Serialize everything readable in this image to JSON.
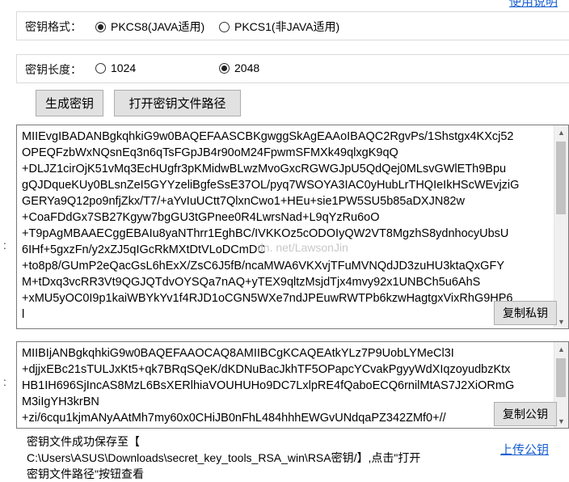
{
  "top_link": "使用说明",
  "format": {
    "label": "密钥格式：",
    "options": [
      "PKCS8(JAVA适用)",
      "PKCS1(非JAVA适用)"
    ],
    "selected": 0
  },
  "length": {
    "label": "密钥长度：",
    "options": [
      "1024",
      "2048"
    ],
    "selected": 1
  },
  "buttons": {
    "generate": "生成密钥",
    "open_path": "打开密钥文件路径"
  },
  "private_key": {
    "lines": [
      "MIIEvgIBADANBgkqhkiG9w0BAQEFAASCBKgwggSkAgEAAoIBAQC2RgvPs/1Shstgx4KXcj52",
      "OPEQFzbWxNQsnEq3n6qTsFGpJB4r90oM24FpwmSFMXk49qlxgK9qQ",
      "+DLJZ1cirOjK51vMq3EcHUgfr3pKMidwBLwzMvoGxcRGWGJpU5QdQej0MLsvGWlETh9Bpu",
      "gQJDqueKUy0BLsnZeI5GYYzeliBgfeSsE37OL/pyq7WSOYA3IAC0yHubLrTHQIeIkHScWEvjziG",
      "GERYa9Q12po9nfjZkx/T7/+aYvIuUCtt7QlxnCwo1+HEu+sie1PW5SU5b85aDXJN82w",
      "+CoaFDdGx7SB27Kgyw7bgGU3tGPnee0R4LwrsNad+L9qYzRu6oO",
      "+T9pAgMBAAECggEBAIu8yaNThrr1EghBC/IVKKOz5cODOIyQW2VT8MgzhS8ydnhocyUbsU",
      "6IHf+5gxzFn/y2xZJ5qIGcRkMXtDtVLoDCmDC",
      "+to8p8/GUmP2eQacGsL6hExX/ZsC6J5fB/ncaMWA6VKXvjTFuMVNQdJD3zuHU3ktaQxGFY",
      "M+tDxq3vcRR3Vt9QGJQTdvOYSQa7nAQ+yTEX9qltzMsjdTjx4mvy92x1UNBCh5u6AhS",
      "+xMU5yOC0I9p1kaiWBYkYv1f4RJD1oCGN5WXe7ndJPEuwRWTPb6kzwHagtgxVixRhG9HP6",
      "l"
    ],
    "copy_label": "复制私钥"
  },
  "public_key": {
    "lines": [
      "MIIBIjANBgkqhkiG9w0BAQEFAAOCAQ8AMIIBCgKCAQEAtkYLz7P9UobLYMeCl3I",
      "+djjxEBc21sTULJxKt5+qk7BRqSQeK/dKDNuBacJkhTF5OPapcYCvakPgyyWdXIqzoyudbzKtx",
      "HB1IH696SjIncAS8MzL6BsXERlhiaVOUHUHo9DC7LxlpRE4fQaboECQ6rnilMtAS7J2XiORmG",
      "M3iIgYH3krBN",
      "+zi/6cqu1kjmANyAAtMh7my60x0CHiJB0nFhL484hhhEWGvUNdqaPZ342ZMf0+//"
    ],
    "copy_label": "复制公钥"
  },
  "watermark": "dn. net/LawsonJin",
  "status": {
    "lines": [
      "密钥文件成功保存至【",
      "C:\\Users\\ASUS\\Downloads\\secret_key_tools_RSA_win\\RSA密钥/】,点击\"打开",
      "密钥文件路径\"按钮查看"
    ]
  },
  "upload_link": "上传公钥",
  "side_colon": ":",
  "icons": {
    "scroll_up": "▲",
    "scroll_down": "▼"
  }
}
